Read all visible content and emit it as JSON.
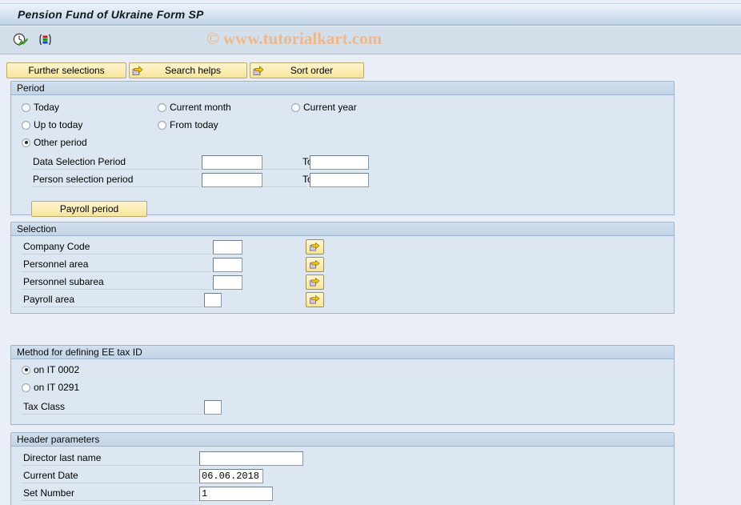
{
  "window": {
    "title": "Pension Fund of Ukraine Form SP"
  },
  "watermark": "© www.tutorialkart.com",
  "toolbar": {
    "icons": [
      {
        "name": "execute-clock-icon",
        "tooltip": "Execute"
      },
      {
        "name": "color-bars-icon",
        "tooltip": "Variants"
      }
    ]
  },
  "selection_buttons": {
    "further_selections": "Further selections",
    "search_helps": "Search helps",
    "sort_order": "Sort order"
  },
  "period": {
    "title": "Period",
    "radios": [
      {
        "label": "Today",
        "checked": false
      },
      {
        "label": "Current month",
        "checked": false
      },
      {
        "label": "Current year",
        "checked": false
      },
      {
        "label": "Up to today",
        "checked": false
      },
      {
        "label": "From today",
        "checked": false
      },
      {
        "label": "Other period",
        "checked": true
      }
    ],
    "fields": [
      {
        "label": "Data Selection Period",
        "value": "",
        "to_label": "To",
        "to_value": ""
      },
      {
        "label": "Person selection period",
        "value": "",
        "to_label": "To",
        "to_value": ""
      }
    ],
    "payroll_period_button": "Payroll period"
  },
  "selection": {
    "title": "Selection",
    "rows": [
      {
        "label": "Company Code",
        "value": ""
      },
      {
        "label": "Personnel area",
        "value": ""
      },
      {
        "label": "Personnel subarea",
        "value": ""
      },
      {
        "label": "Payroll area",
        "value": ""
      }
    ]
  },
  "method": {
    "title": "Method for defining EE tax ID",
    "radios": [
      {
        "label": "on IT 0002",
        "checked": true
      },
      {
        "label": "on IT 0291",
        "checked": false
      }
    ],
    "tax_class": {
      "label": "Tax Class",
      "value": ""
    }
  },
  "header_parameters": {
    "title": "Header parameters",
    "rows": [
      {
        "label": "Director last name",
        "value": ""
      },
      {
        "label": "Current Date",
        "value": "06.06.2018"
      },
      {
        "label": "Set Number",
        "value": "1"
      }
    ]
  },
  "colors": {
    "titlebar_top": "#eef3fa",
    "titlebar_bottom": "#aec6de",
    "toolbar_bg": "#d3dfeb",
    "page_bg": "#eaeff7",
    "group_bg": "#dde7f1",
    "group_title_bg": "#c2d4e6",
    "group_border": "#9cb4cd",
    "button_yellow": "#fbeeb4",
    "watermark": "#f0b888"
  }
}
